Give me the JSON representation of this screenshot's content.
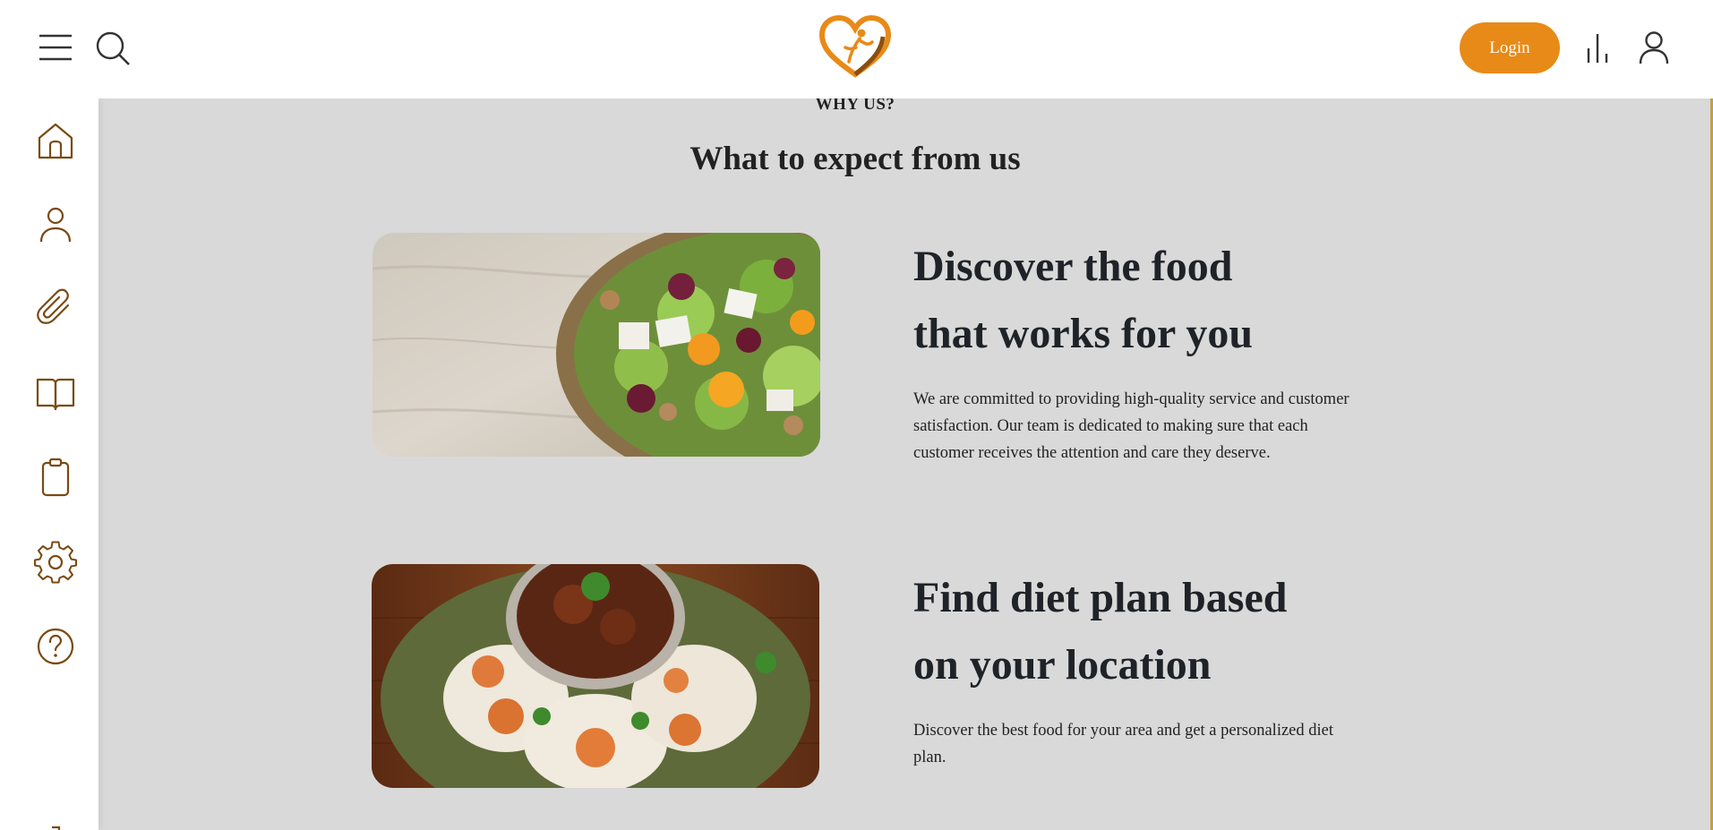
{
  "header": {
    "menu_icon": "hamburger-icon",
    "search_icon": "search-icon",
    "logo": "heart-logo",
    "login_label": "Login",
    "stats_icon": "bar-chart-icon",
    "user_icon": "user-icon"
  },
  "sidebar": {
    "items": [
      {
        "name": "home",
        "icon": "home-icon"
      },
      {
        "name": "profile",
        "icon": "user-icon"
      },
      {
        "name": "attachments",
        "icon": "paperclip-icon"
      },
      {
        "name": "recipes",
        "icon": "book-icon"
      },
      {
        "name": "plans",
        "icon": "clipboard-icon"
      },
      {
        "name": "settings",
        "icon": "gear-icon"
      },
      {
        "name": "help",
        "icon": "help-icon"
      }
    ]
  },
  "colors": {
    "accent": "#e88a17",
    "icon": "#7a4a12",
    "background": "#d9d9d9"
  },
  "why": {
    "eyebrow": "WHY US?",
    "title": "What to expect from us"
  },
  "features": [
    {
      "title_line1": "Discover the food",
      "title_line2": "that works for you",
      "text": "We are committed to providing high-quality service and customer satisfaction. Our team is dedicated to making sure that each customer receives the attention and care they deserve.",
      "image": "salad-bowl-photo"
    },
    {
      "title_line1": "Find diet plan based",
      "title_line2": "on your location",
      "text": "Discover the best food for your area and get a personalized diet plan.",
      "image": "curry-noodles-photo"
    }
  ]
}
